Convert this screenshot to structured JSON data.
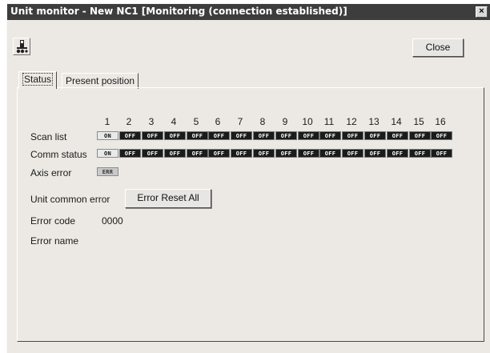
{
  "window": {
    "title": "Unit monitor - New NC1 [Monitoring (connection established)]",
    "close_glyph": "×"
  },
  "toolbar": {
    "close_label": "Close",
    "unit_icon": "unit-monitor-icon"
  },
  "tabs": [
    {
      "label": "Status",
      "active": true
    },
    {
      "label": "Present position",
      "active": false
    }
  ],
  "status": {
    "axis_numbers": [
      "1",
      "2",
      "3",
      "4",
      "5",
      "6",
      "7",
      "8",
      "9",
      "10",
      "11",
      "12",
      "13",
      "14",
      "15",
      "16"
    ],
    "rows": {
      "scan_list": {
        "label": "Scan list",
        "values": [
          "ON",
          "OFF",
          "OFF",
          "OFF",
          "OFF",
          "OFF",
          "OFF",
          "OFF",
          "OFF",
          "OFF",
          "OFF",
          "OFF",
          "OFF",
          "OFF",
          "OFF",
          "OFF"
        ]
      },
      "comm_status": {
        "label": "Comm status",
        "values": [
          "ON",
          "OFF",
          "OFF",
          "OFF",
          "OFF",
          "OFF",
          "OFF",
          "OFF",
          "OFF",
          "OFF",
          "OFF",
          "OFF",
          "OFF",
          "OFF",
          "OFF",
          "OFF"
        ]
      },
      "axis_error": {
        "label": "Axis error",
        "value": "ERR"
      }
    },
    "unit_common_error": {
      "label": "Unit common error",
      "button_label": "Error Reset All"
    },
    "error_code": {
      "label": "Error code",
      "value": "0000"
    },
    "error_name": {
      "label": "Error name",
      "value": ""
    }
  }
}
